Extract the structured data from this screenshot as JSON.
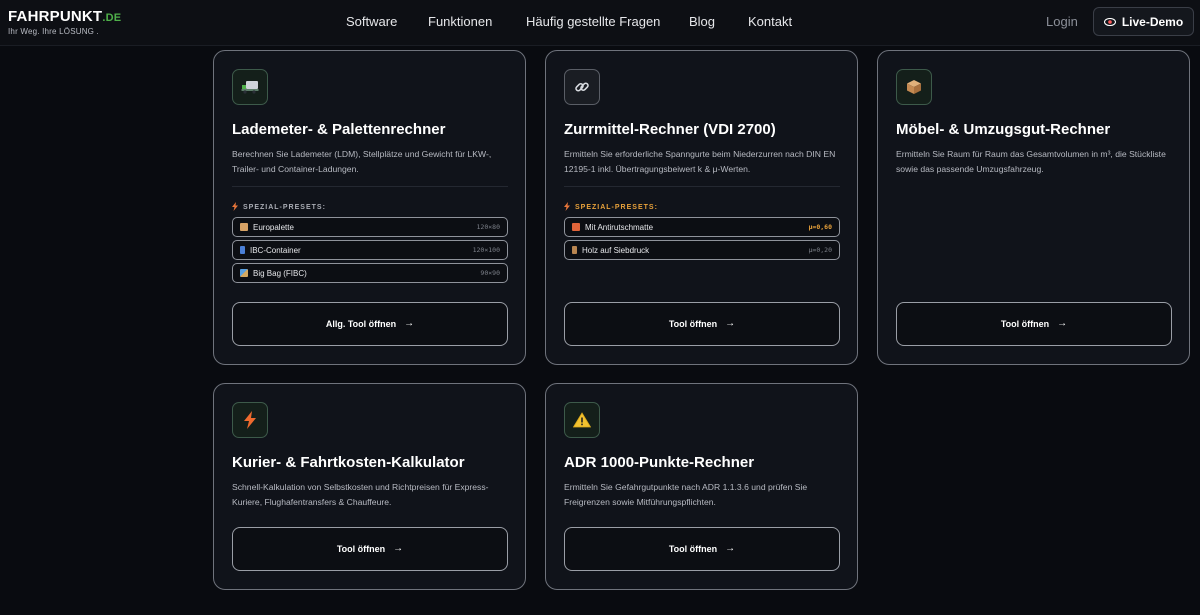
{
  "header": {
    "logo_main": "FAHRPUNKT",
    "logo_tld": ".DE",
    "logo_sub": "Ihr Weg. Ihre LÖSUNG .",
    "nav": [
      "Software",
      "Funktionen",
      "Häufig gestellte Fragen",
      "Blog",
      "Kontakt"
    ],
    "login": "Login",
    "demo": "Live-Demo"
  },
  "cards": [
    {
      "title": "Lademeter- & Palettenrechner",
      "desc": "Berechnen Sie Lademeter (LDM), Stellplätze und Gewicht für LKW-, Trailer- und Container-Ladungen.",
      "icon": "truck-icon",
      "presets_label": "SPEZIAL-PRESETS:",
      "presets": [
        {
          "label": "Europalette",
          "value": "120×80"
        },
        {
          "label": "IBC-Container",
          "value": "120×100"
        },
        {
          "label": "Big Bag (FIBC)",
          "value": "90×90"
        }
      ],
      "button": "Allg. Tool öffnen"
    },
    {
      "title": "Zurrmittel-Rechner (VDI 2700)",
      "desc": "Ermitteln Sie erforderliche Spanngurte beim Niederzurren nach DIN EN 12195-1 inkl. Übertragungsbeiwert k & μ-Werten.",
      "icon": "chain-link-icon",
      "presets_label": "SPEZIAL-PRESETS:",
      "presets": [
        {
          "label": "Mit Antirutschmatte",
          "value": "μ=0,60"
        },
        {
          "label": "Holz auf Siebdruck",
          "value": "μ=0,20"
        }
      ],
      "button": "Tool öffnen"
    },
    {
      "title": "Möbel- & Umzugsgut-Rechner",
      "desc": "Ermitteln Sie Raum für Raum das Gesamtvolumen in m³, die Stückliste sowie das passende Umzugsfahrzeug.",
      "icon": "box-icon",
      "button": "Tool öffnen"
    },
    {
      "title": "Kurier- & Fahrtkosten-Kalkulator",
      "desc": "Schnell-Kalkulation von Selbstkosten und Richtpreisen für Express-Kuriere, Flughafentransfers & Chauffeure.",
      "icon": "lightning-icon",
      "button": "Tool öffnen"
    },
    {
      "title": "ADR 1000-Punkte-Rechner",
      "desc": "Ermitteln Sie Gefahrgutpunkte nach ADR 1.1.3.6 und prüfen Sie Freigrenzen sowie Mitführungspflichten.",
      "icon": "warning-icon",
      "button": "Tool öffnen"
    }
  ],
  "colors": {
    "accent_green": "#4fb04a",
    "accent_orange": "#e8a13a",
    "background": "#090b10",
    "card": "#10131a"
  }
}
